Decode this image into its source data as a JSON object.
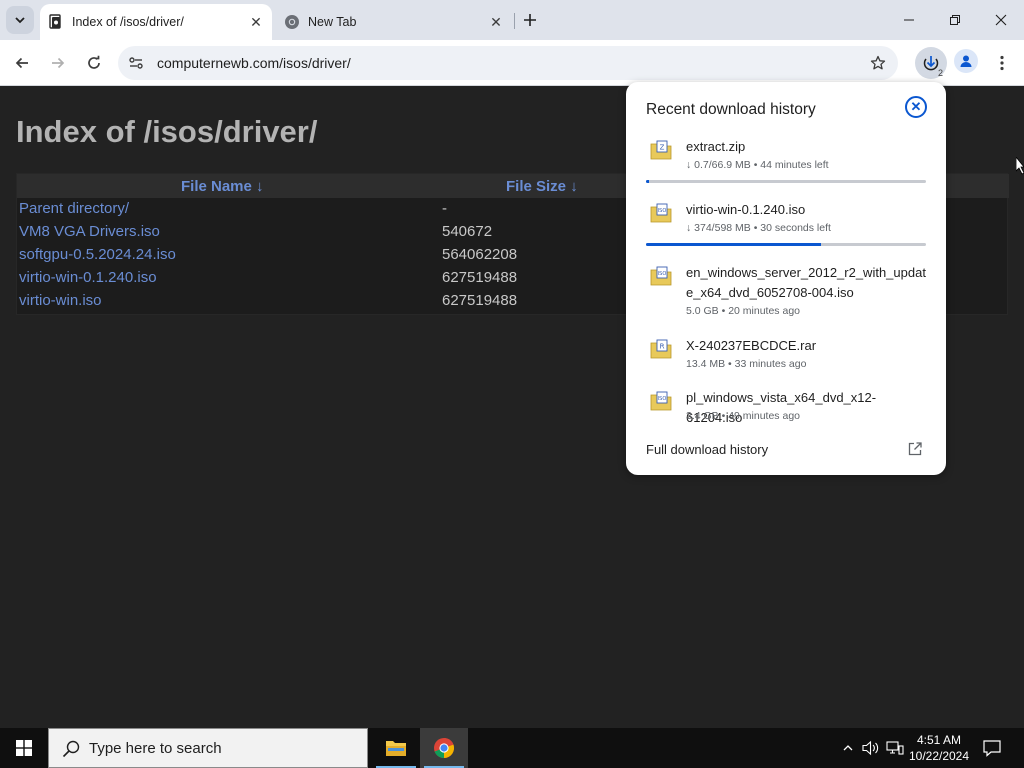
{
  "browser": {
    "tabs": [
      {
        "title": "Index of /isos/driver/",
        "active": true,
        "favicon": "site-icon"
      },
      {
        "title": "New Tab",
        "active": false,
        "favicon": "chrome-icon"
      }
    ],
    "url": "computernewb.com/isos/driver/",
    "download_count": "2"
  },
  "page": {
    "heading": "Index of /isos/driver/",
    "columns": {
      "name": "File Name  ↓",
      "size": "File Size  ↓"
    },
    "rows": [
      {
        "name": "Parent directory/",
        "size": "-"
      },
      {
        "name": "VM8 VGA Drivers.iso",
        "size": "540672"
      },
      {
        "name": "softgpu-0.5.2024.24.iso",
        "size": "564062208"
      },
      {
        "name": "virtio-win-0.1.240.iso",
        "size": "627519488"
      },
      {
        "name": "virtio-win.iso",
        "size": "627519488"
      }
    ]
  },
  "downloads": {
    "title": "Recent download history",
    "items": [
      {
        "name": "extract.zip",
        "status": "↓ 0.7/66.9 MB • 44 minutes left",
        "progress": 0.01,
        "icon": "zip-file-icon"
      },
      {
        "name": "virtio-win-0.1.240.iso",
        "status": "↓ 374/598 MB • 30 seconds left",
        "progress": 0.625,
        "icon": "iso-file-icon"
      },
      {
        "name": "en_windows_server_2012_r2_with_update_x64_dvd_6052708-004.iso",
        "status": "5.0 GB • 20 minutes ago",
        "icon": "iso-file-icon"
      },
      {
        "name": "X-240237EBCDCE.rar",
        "status": "13.4 MB • 33 minutes ago",
        "icon": "rar-file-icon"
      },
      {
        "name": "pl_windows_vista_x64_dvd_x12-61204.iso",
        "status": "3.4 GB • 49 minutes ago",
        "icon": "iso-file-icon"
      }
    ],
    "full_history_label": "Full download history"
  },
  "taskbar": {
    "search_placeholder": "Type here to search",
    "time": "4:51 AM",
    "date": "10/22/2024"
  },
  "colors": {
    "link": "#6a8dd4",
    "accent": "#0b57d0",
    "page_bg": "#222222"
  }
}
